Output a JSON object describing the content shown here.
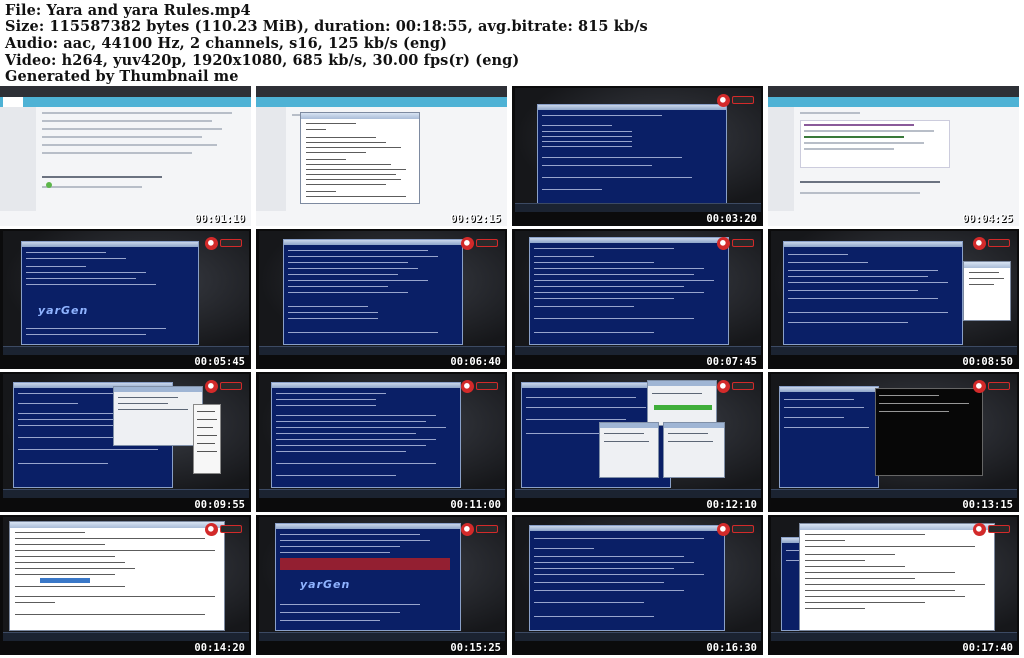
{
  "header": {
    "line1": "File: Yara and yara Rules.mp4",
    "line2": "Size: 115587382 bytes (110.23 MiB), duration: 00:18:55, avg.bitrate: 815 kb/s",
    "line3": "Audio: aac, 44100 Hz, 2 channels, s16, 125 kb/s (eng)",
    "line4": "Video: h264, yuv420p, 1920x1080, 685 kb/s, 30.00 fps(r) (eng)",
    "line5": "Generated by Thumbnail me"
  },
  "thumbnails": [
    {
      "timestamp": "00:01:10",
      "kind": "web-list"
    },
    {
      "timestamp": "00:02:15",
      "kind": "web-editor"
    },
    {
      "timestamp": "00:03:20",
      "kind": "console-light"
    },
    {
      "timestamp": "00:04:25",
      "kind": "web-code"
    },
    {
      "timestamp": "00:05:45",
      "kind": "console-ascii"
    },
    {
      "timestamp": "00:06:40",
      "kind": "console-list"
    },
    {
      "timestamp": "00:07:45",
      "kind": "console-full"
    },
    {
      "timestamp": "00:08:50",
      "kind": "console-editor"
    },
    {
      "timestamp": "00:09:55",
      "kind": "console-menu"
    },
    {
      "timestamp": "00:11:00",
      "kind": "console-text"
    },
    {
      "timestamp": "00:12:10",
      "kind": "console-dialogs"
    },
    {
      "timestamp": "00:13:15",
      "kind": "console-black"
    },
    {
      "timestamp": "00:14:20",
      "kind": "editor-rule"
    },
    {
      "timestamp": "00:15:25",
      "kind": "console-ascii-red"
    },
    {
      "timestamp": "00:16:30",
      "kind": "console-plain"
    },
    {
      "timestamp": "00:17:40",
      "kind": "editor-rules-2"
    }
  ],
  "colors": {
    "console_bg": "#0a1f66",
    "web_nav": "#4eb2d5",
    "badge_red": "#d32a2a",
    "timestamp_text": "#ffffff"
  },
  "icons": [
    "learn-logo-icon",
    "taskbar-icon"
  ]
}
